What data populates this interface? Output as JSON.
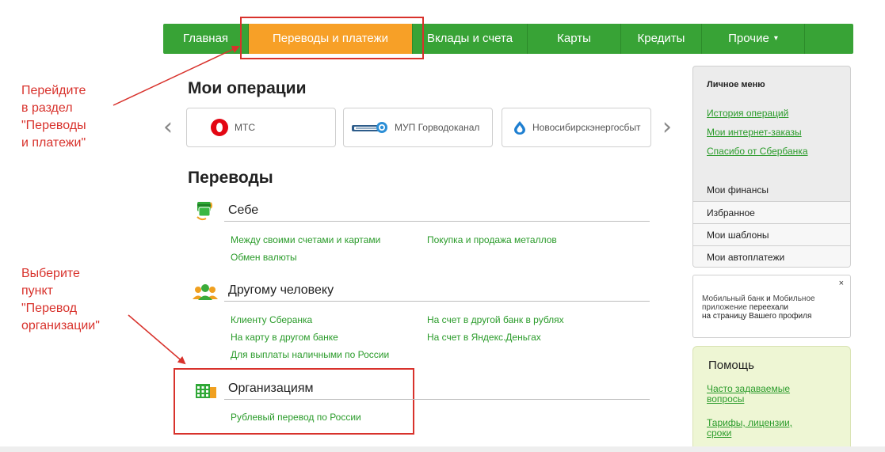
{
  "nav": {
    "items": [
      {
        "label": "Главная"
      },
      {
        "label": "Переводы и платежи"
      },
      {
        "label": "Вклады и счета"
      },
      {
        "label": "Карты"
      },
      {
        "label": "Кредиты"
      },
      {
        "label": "Прочие"
      }
    ]
  },
  "annotations": {
    "a1": [
      "Перейдите",
      "в раздел",
      "\"Переводы",
      "и платежи\""
    ],
    "a2": [
      "Выберите",
      "пункт",
      "\"Перевод",
      "организации\""
    ]
  },
  "operations": {
    "title": "Мои операции",
    "cards": [
      {
        "label": "МТС",
        "icon": "mts-logo-icon"
      },
      {
        "label": "МУП Горводоканал",
        "icon": "gorvodokanal-logo-icon"
      },
      {
        "label": "Новосибирскэнергосбыт",
        "icon": "water-drop-logo-icon"
      }
    ],
    "prev_arrow": "‹",
    "next_arrow": "›"
  },
  "transfers": {
    "title": "Переводы",
    "self": {
      "title": "Себе",
      "links": [
        "Между своими счетами и картами",
        "Обмен валюты",
        "Покупка и продажа металлов"
      ]
    },
    "person": {
      "title": "Другому человеку",
      "links": [
        "Клиенту Сберанка",
        "На карту в другом банке",
        "Для выплаты наличными по России",
        "На счет в другой банк в рублях",
        "На счет в Яндекс.Деньгах"
      ]
    },
    "org": {
      "title": "Организациям",
      "links": [
        "Рублевый перевод по России"
      ]
    }
  },
  "sidebar": {
    "title": "Личное меню",
    "links": [
      "История операций",
      "Мои интернет-заказы",
      "Спасибо от Сбербанка"
    ],
    "rows": [
      "Мои финансы",
      "Избранное",
      "Мои шаблоны",
      "Мои автоплатежи"
    ]
  },
  "notice": {
    "close": "×",
    "line1a": "Мобильный банк",
    "line1b": " и ",
    "line1c": "Мобильное",
    "line2a": "приложение",
    "line2b": " переехали",
    "line3": "на страницу Вашего профиля"
  },
  "help": {
    "title": "Помощь",
    "links": [
      "Часто задаваемые вопросы",
      "Тарифы, лицензии, сроки"
    ]
  },
  "colors": {
    "brand_green": "#38a336",
    "active_orange": "#f7a027",
    "link_green": "#2a9b2a",
    "annotation_red": "#d8322c"
  }
}
